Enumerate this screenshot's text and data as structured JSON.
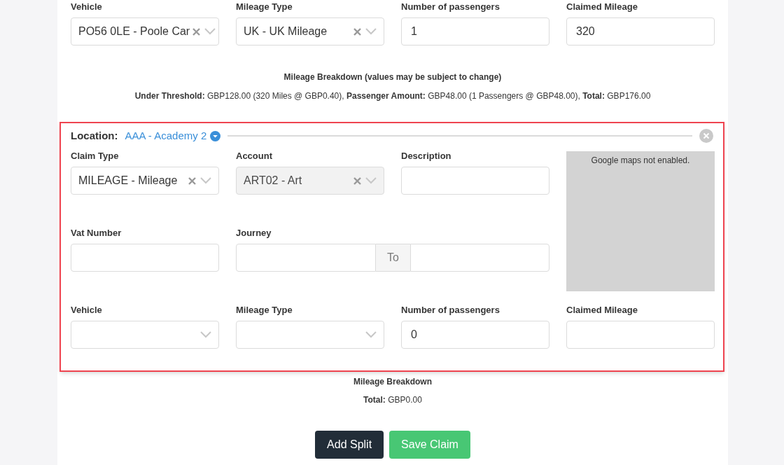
{
  "top_fields": [
    {
      "kind": "select",
      "label": "Vehicle",
      "value": "PO56 0LE - Poole Car",
      "clearable": true,
      "disabled": false
    },
    {
      "kind": "select",
      "label": "Mileage Type",
      "value": "UK - UK Mileage",
      "clearable": true,
      "disabled": false
    },
    {
      "kind": "input",
      "label": "Number of passengers",
      "value": "1"
    },
    {
      "kind": "input",
      "label": "Claimed Mileage",
      "value": "320"
    }
  ],
  "top_breakdown": {
    "title": "Mileage Breakdown (values may be subject to change)",
    "line": "**Under Threshold:** GBP128.00 (320 Miles @ GBP0.40), **Passenger Amount:** GBP48.00 (1 Passengers @ GBP48.00), **Total:** GBP176.00"
  },
  "split": {
    "location_label": "Location:",
    "location_value": "AAA - Academy 2",
    "map_message": "Google maps not enabled.",
    "rows": [
      [
        {
          "kind": "select",
          "label": "Claim Type",
          "value": "MILEAGE - Mileage",
          "clearable": true,
          "disabled": false
        },
        {
          "kind": "select",
          "label": "Account",
          "value": "ART02 - Art",
          "clearable": true,
          "disabled": true
        },
        {
          "kind": "input",
          "label": "Description"
        }
      ],
      [
        {
          "kind": "input",
          "label": "Vat Number"
        },
        {
          "kind": "journey",
          "label": "Journey",
          "to_label": "To"
        }
      ],
      [
        {
          "kind": "select",
          "label": "Vehicle",
          "clearable": false,
          "disabled": false
        },
        {
          "kind": "select",
          "label": "Mileage Type",
          "clearable": false,
          "disabled": false
        },
        {
          "kind": "input",
          "label": "Number of passengers",
          "value": "0"
        },
        {
          "kind": "input",
          "label": "Claimed Mileage"
        }
      ]
    ]
  },
  "bottom_breakdown": {
    "title": "Mileage Breakdown",
    "line": "**Total:** GBP0.00"
  },
  "buttons": [
    {
      "label": "Add Split",
      "kind": "dark"
    },
    {
      "label": "Save Claim",
      "kind": "success"
    }
  ]
}
